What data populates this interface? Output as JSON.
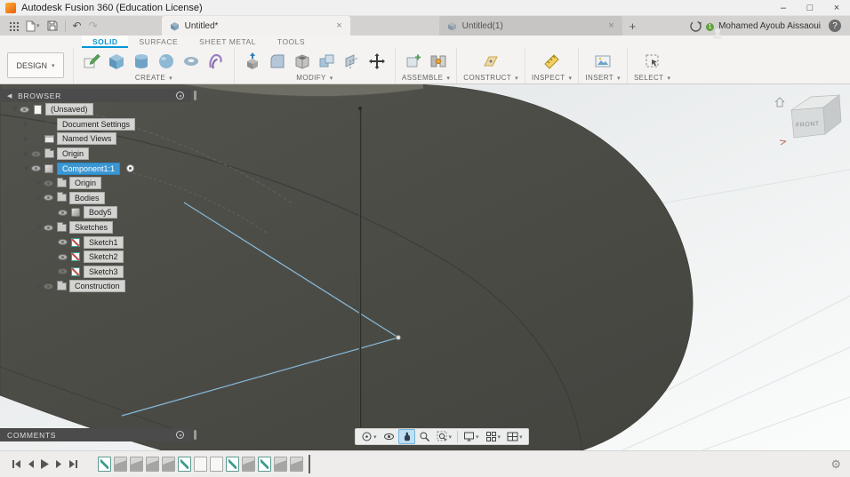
{
  "glyphs": {
    "dropdown": "▾",
    "close": "×",
    "minimize": "–",
    "maximize": "□",
    "undo": "↶",
    "redo": "↷",
    "collapse": "◀",
    "gear": "⚙",
    "help": "?",
    "plus": "+"
  },
  "title_bar": {
    "title": "Autodesk Fusion 360 (Education License)"
  },
  "tab_strip": {
    "active_tab": "Untitled*",
    "inactive_tab": "Untitled(1)"
  },
  "account": {
    "user_name": "Mohamed Ayoub Aissaoui",
    "notification_count": "1"
  },
  "ribbon": {
    "tabs": {
      "solid": "SOLID",
      "surface": "SURFACE",
      "sheet_metal": "SHEET METAL",
      "tools": "TOOLS"
    },
    "design_label": "DESIGN",
    "group_labels": {
      "create": "CREATE",
      "modify": "MODIFY",
      "assemble": "ASSEMBLE",
      "construct": "CONSTRUCT",
      "inspect": "INSPECT",
      "insert": "INSERT",
      "select": "SELECT"
    }
  },
  "browser": {
    "header": "BROWSER",
    "rows": [
      {
        "label": "(Unsaved)"
      },
      {
        "label": "Document Settings"
      },
      {
        "label": "Named Views"
      },
      {
        "label": "Origin"
      },
      {
        "label": "Component1:1",
        "selected": true
      },
      {
        "label": "Origin"
      },
      {
        "label": "Bodies"
      },
      {
        "label": "Body5"
      },
      {
        "label": "Sketches"
      },
      {
        "label": "Sketch1"
      },
      {
        "label": "Sketch2"
      },
      {
        "label": "Sketch3"
      },
      {
        "label": "Construction"
      }
    ]
  },
  "viewcube": {
    "face_label": "FRONT"
  },
  "comments_panel": {
    "header": "COMMENTS"
  },
  "colors": {
    "accent": "#0696d7",
    "selection": "#3b97d3",
    "model_body": "#4b4b47"
  }
}
